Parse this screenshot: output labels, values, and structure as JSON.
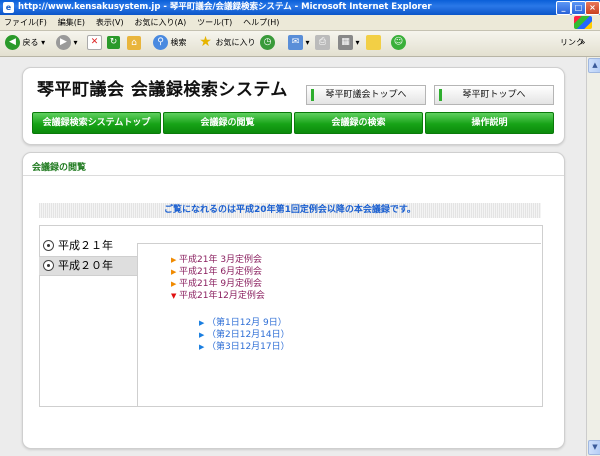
{
  "window": {
    "title": "http://www.kensakusystem.jp - 琴平町議会/会議録検索システム - Microsoft Internet Explorer"
  },
  "menubar": {
    "items": [
      "ファイル(F)",
      "編集(E)",
      "表示(V)",
      "お気に入り(A)",
      "ツール(T)",
      "ヘルプ(H)"
    ]
  },
  "toolbar": {
    "back_label": "戻る",
    "search_label": "検索",
    "favorites_label": "お気に入り",
    "links_label": "リンク"
  },
  "header": {
    "site_title": "琴平町議会 会議録検索システム",
    "link_assembly_top": "琴平町議会トップへ",
    "link_town_top": "琴平町トップへ",
    "nav": [
      "会議録検索システムトップ",
      "会議録の閲覧",
      "会議録の検索",
      "操作説明"
    ]
  },
  "section": {
    "title": "会議録の閲覧",
    "notice": "ご覧になれるのは平成20年第1回定例会以降の本会議録です。"
  },
  "years": [
    {
      "label": "平成２１年",
      "selected": false
    },
    {
      "label": "平成２０年",
      "selected": true
    }
  ],
  "sessions": [
    {
      "label": "平成21年 3月定例会",
      "expanded": false
    },
    {
      "label": "平成21年 6月定例会",
      "expanded": false
    },
    {
      "label": "平成21年 9月定例会",
      "expanded": false
    },
    {
      "label": "平成21年12月定例会",
      "expanded": true
    }
  ],
  "days": [
    "（第1日12月 9日）",
    "（第2日12月14日）",
    "（第3日12月17日）"
  ],
  "colors": {
    "nav_green": "#17a317",
    "section_title": "#1f7a1f",
    "notice_blue": "#1a5fd0",
    "session_text": "#8a1f5f",
    "day_text": "#2f6fd6"
  }
}
